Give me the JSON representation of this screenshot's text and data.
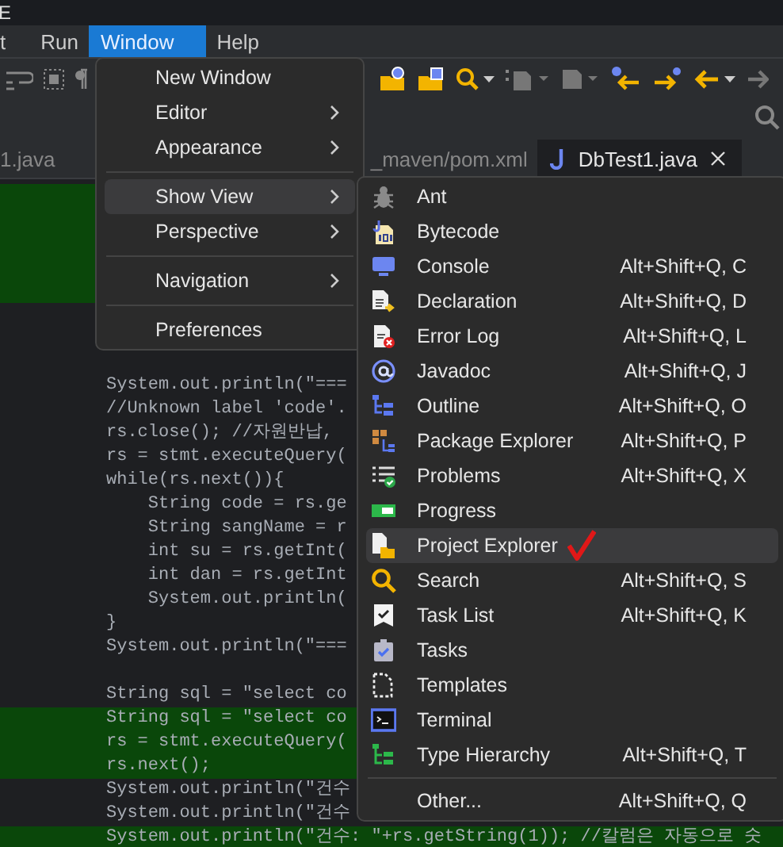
{
  "title_bar": {
    "title": "E"
  },
  "menu_bar": [
    {
      "label": "t",
      "selected": false
    },
    {
      "label": "Run",
      "selected": false
    },
    {
      "label": "Window",
      "selected": true
    },
    {
      "label": "Help",
      "selected": false
    }
  ],
  "editor_tabs": [
    {
      "label": "1.java",
      "selected": false
    },
    {
      "label": "_maven/pom.xml",
      "selected": false
    },
    {
      "label": "DbTest1.java",
      "selected": true
    }
  ],
  "code_lines": [
    {
      "kind": "blank",
      "highlighted": true
    },
    {
      "kind": "blank",
      "highlighted": true
    },
    {
      "kind": "blank",
      "highlighted": true
    },
    {
      "kind": "blank",
      "highlighted": true
    },
    {
      "kind": "blank",
      "highlighted": true
    },
    {
      "kind": "blank",
      "highlighted": false
    },
    {
      "kind": "blank",
      "highlighted": false
    },
    {
      "kind": "blank",
      "highlighted": false
    },
    {
      "kind": "code",
      "text": "System.out.println(\"===",
      "highlighted": false
    },
    {
      "kind": "code",
      "text": "//Unknown label 'code'.",
      "highlighted": false
    },
    {
      "kind": "code",
      "text": "rs.close(); //자원반납,",
      "highlighted": false
    },
    {
      "kind": "code",
      "text": "rs = stmt.executeQuery(",
      "highlighted": false
    },
    {
      "kind": "code",
      "text": "while(rs.next()){",
      "highlighted": false
    },
    {
      "kind": "code",
      "text": "    String code = rs.ge",
      "highlighted": false
    },
    {
      "kind": "code",
      "text": "    String sangName = r",
      "highlighted": false
    },
    {
      "kind": "code",
      "text": "    int su = rs.getInt(",
      "highlighted": false
    },
    {
      "kind": "code",
      "text": "    int dan = rs.getInt",
      "highlighted": false
    },
    {
      "kind": "code",
      "text": "    System.out.println(",
      "highlighted": false
    },
    {
      "kind": "code",
      "text": "}",
      "highlighted": false
    },
    {
      "kind": "code",
      "text": "System.out.println(\"===",
      "highlighted": false
    },
    {
      "kind": "blank",
      "highlighted": false
    },
    {
      "kind": "code",
      "text": "String sql = \"select co",
      "highlighted": false
    },
    {
      "kind": "code",
      "text": "String sql = \"select co",
      "highlighted": true
    },
    {
      "kind": "code",
      "text": "rs = stmt.executeQuery(",
      "highlighted": true
    },
    {
      "kind": "code",
      "text": "rs.next();",
      "highlighted": true
    },
    {
      "kind": "code",
      "text": "System.out.println(\"건수",
      "highlighted": false
    },
    {
      "kind": "code",
      "text": "System.out.println(\"건수",
      "highlighted": false
    },
    {
      "kind": "code",
      "text": "System.out.println(\"건수: \"+rs.getString(1)); //칼럼은 자동으로 숫",
      "highlighted": true
    }
  ],
  "window_menu": {
    "items": [
      {
        "kind": "item",
        "label": "New Window",
        "submenu": false,
        "selected": false
      },
      {
        "kind": "item",
        "label": "Editor",
        "submenu": true,
        "selected": false
      },
      {
        "kind": "item",
        "label": "Appearance",
        "submenu": true,
        "selected": false
      },
      {
        "kind": "separator"
      },
      {
        "kind": "item",
        "label": "Show View",
        "submenu": true,
        "selected": true
      },
      {
        "kind": "item",
        "label": "Perspective",
        "submenu": true,
        "selected": false
      },
      {
        "kind": "separator"
      },
      {
        "kind": "item",
        "label": "Navigation",
        "submenu": true,
        "selected": false
      },
      {
        "kind": "separator"
      },
      {
        "kind": "item",
        "label": "Preferences",
        "submenu": false,
        "selected": false
      }
    ]
  },
  "show_view_menu": {
    "items": [
      {
        "kind": "item",
        "label": "Ant",
        "selected": false
      },
      {
        "kind": "item",
        "label": "Bytecode",
        "selected": false
      },
      {
        "kind": "item",
        "label": "Console",
        "shortcut": "Alt+Shift+Q, C",
        "selected": false
      },
      {
        "kind": "item",
        "label": "Declaration",
        "shortcut": "Alt+Shift+Q, D",
        "selected": false
      },
      {
        "kind": "item",
        "label": "Error Log",
        "shortcut": "Alt+Shift+Q, L",
        "selected": false
      },
      {
        "kind": "item",
        "label": "Javadoc",
        "shortcut": "Alt+Shift+Q, J",
        "selected": false
      },
      {
        "kind": "item",
        "label": "Outline",
        "shortcut": "Alt+Shift+Q, O",
        "selected": false
      },
      {
        "kind": "item",
        "label": "Package Explorer",
        "shortcut": "Alt+Shift+Q, P",
        "selected": false
      },
      {
        "kind": "item",
        "label": "Problems",
        "shortcut": "Alt+Shift+Q, X",
        "selected": false
      },
      {
        "kind": "item",
        "label": "Progress",
        "selected": false
      },
      {
        "kind": "item",
        "label": "Project Explorer",
        "selected": true
      },
      {
        "kind": "item",
        "label": "Search",
        "shortcut": "Alt+Shift+Q, S",
        "selected": false
      },
      {
        "kind": "item",
        "label": "Task List",
        "shortcut": "Alt+Shift+Q, K",
        "selected": false
      },
      {
        "kind": "item",
        "label": "Tasks",
        "selected": false
      },
      {
        "kind": "item",
        "label": "Templates",
        "selected": false
      },
      {
        "kind": "item",
        "label": "Terminal",
        "selected": false
      },
      {
        "kind": "item",
        "label": "Type Hierarchy",
        "shortcut": "Alt+Shift+Q, T",
        "selected": false
      },
      {
        "kind": "separator"
      },
      {
        "kind": "item",
        "label": "Other...",
        "shortcut": "Alt+Shift+Q, Q",
        "selected": false
      }
    ]
  }
}
